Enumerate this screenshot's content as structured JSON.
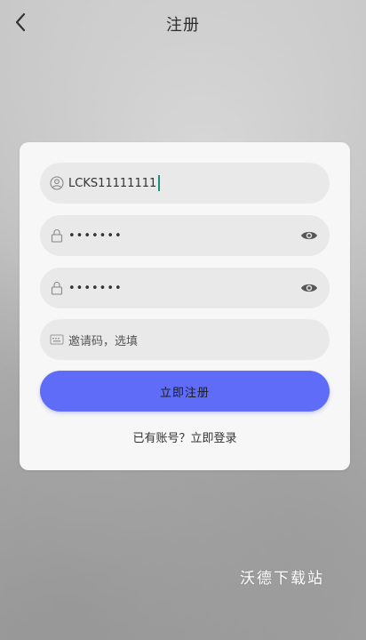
{
  "header": {
    "title": "注册"
  },
  "form": {
    "username": {
      "value": "LCKS11111111"
    },
    "password": {
      "value": "•••••••"
    },
    "confirm_password": {
      "value": "•••••••"
    },
    "invite_code": {
      "placeholder": "邀请码，选填"
    },
    "submit_label": "立即注册",
    "login_link": "已有账号？立即登录"
  },
  "watermark": "沃德下载站",
  "colors": {
    "accent": "#5e6cf8",
    "cursor": "#1a8f86"
  },
  "icons": {
    "back": "chevron-left-icon",
    "user": "user-icon",
    "lock": "lock-icon",
    "eye": "eye-icon",
    "invite": "keyboard-icon"
  }
}
